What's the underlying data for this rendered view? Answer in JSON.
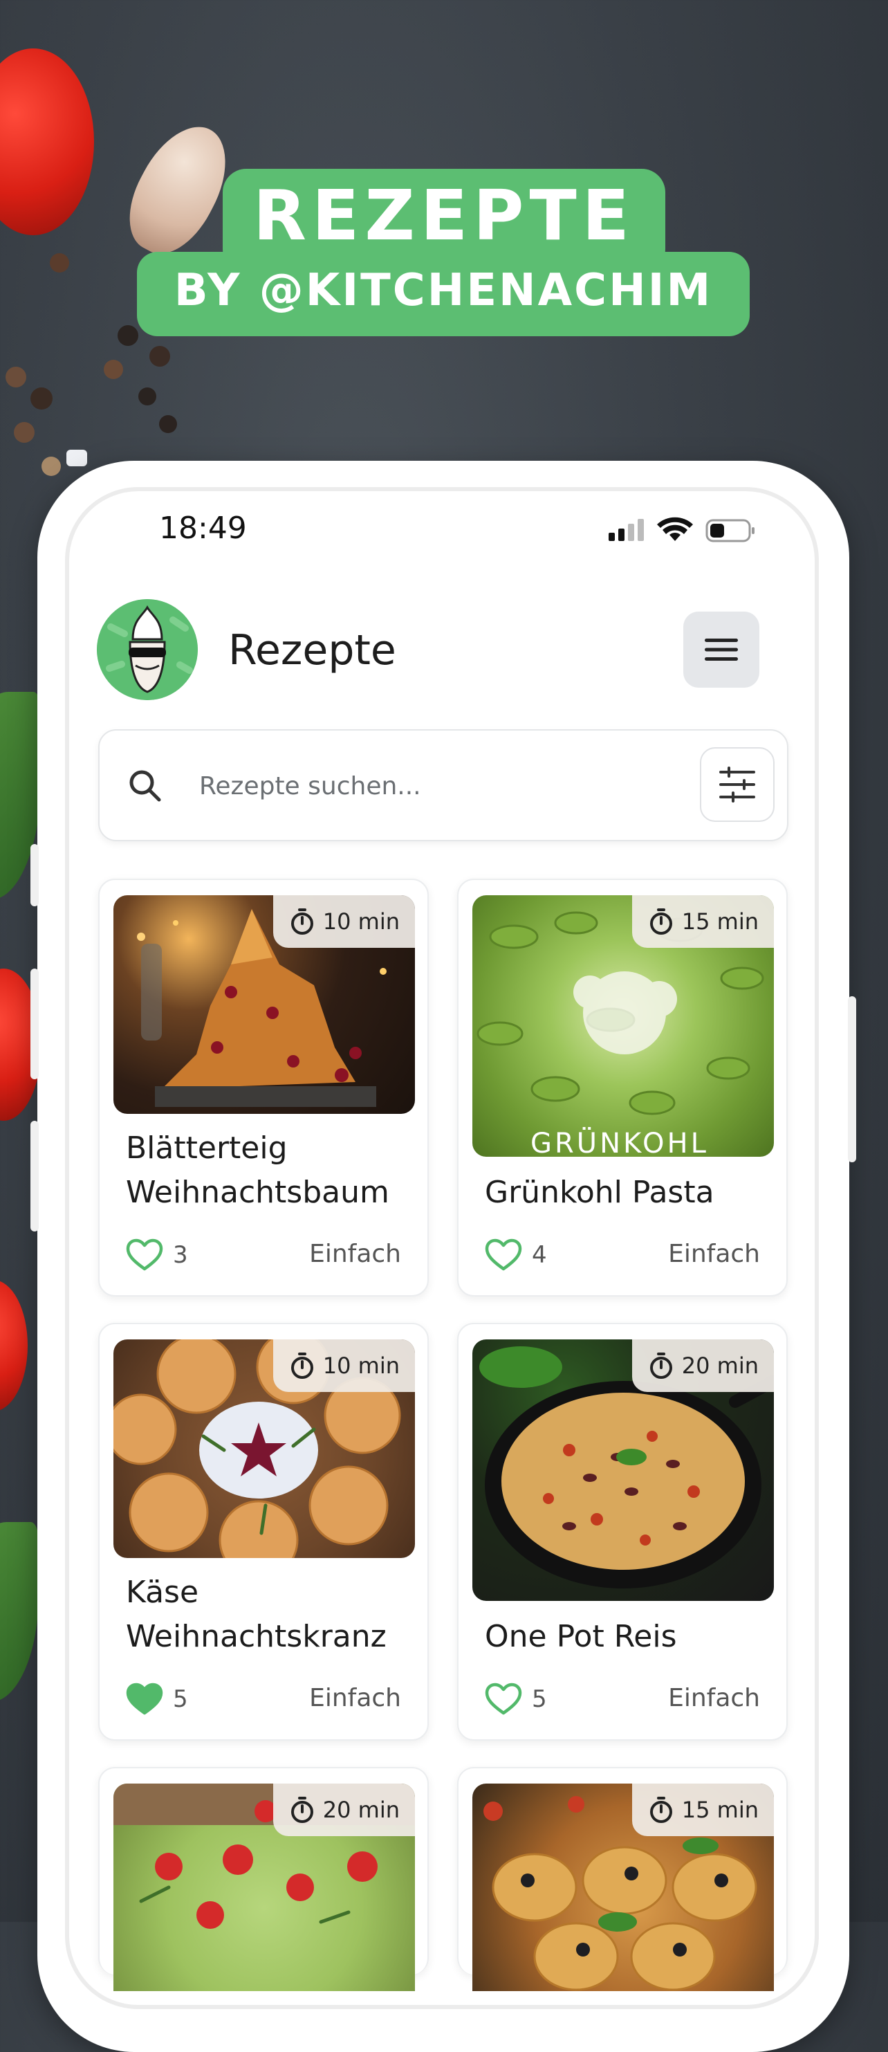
{
  "banner": {
    "title": "REZEPTE",
    "subtitle": "BY @KITCHENACHIM"
  },
  "status_bar": {
    "time": "18:49"
  },
  "header": {
    "title": "Rezepte"
  },
  "search": {
    "placeholder": "Rezepte suchen..."
  },
  "colors": {
    "brand_green": "#5cbe72",
    "heart_green": "#52b96a"
  },
  "recipes": [
    {
      "time": "10 min",
      "title": "Blätterteig Weihnachtsbaum",
      "likes": "3",
      "liked": false,
      "difficulty": "Einfach"
    },
    {
      "time": "15 min",
      "title": "Grünkohl Pasta",
      "likes": "4",
      "liked": false,
      "difficulty": "Einfach",
      "image_text": "GRÜNKOHL"
    },
    {
      "time": "10 min",
      "title": "Käse Weihnachtskranz",
      "likes": "5",
      "liked": true,
      "difficulty": "Einfach"
    },
    {
      "time": "20 min",
      "title": "One Pot Reis",
      "likes": "5",
      "liked": false,
      "difficulty": "Einfach"
    },
    {
      "time": "20 min"
    },
    {
      "time": "15 min"
    }
  ]
}
